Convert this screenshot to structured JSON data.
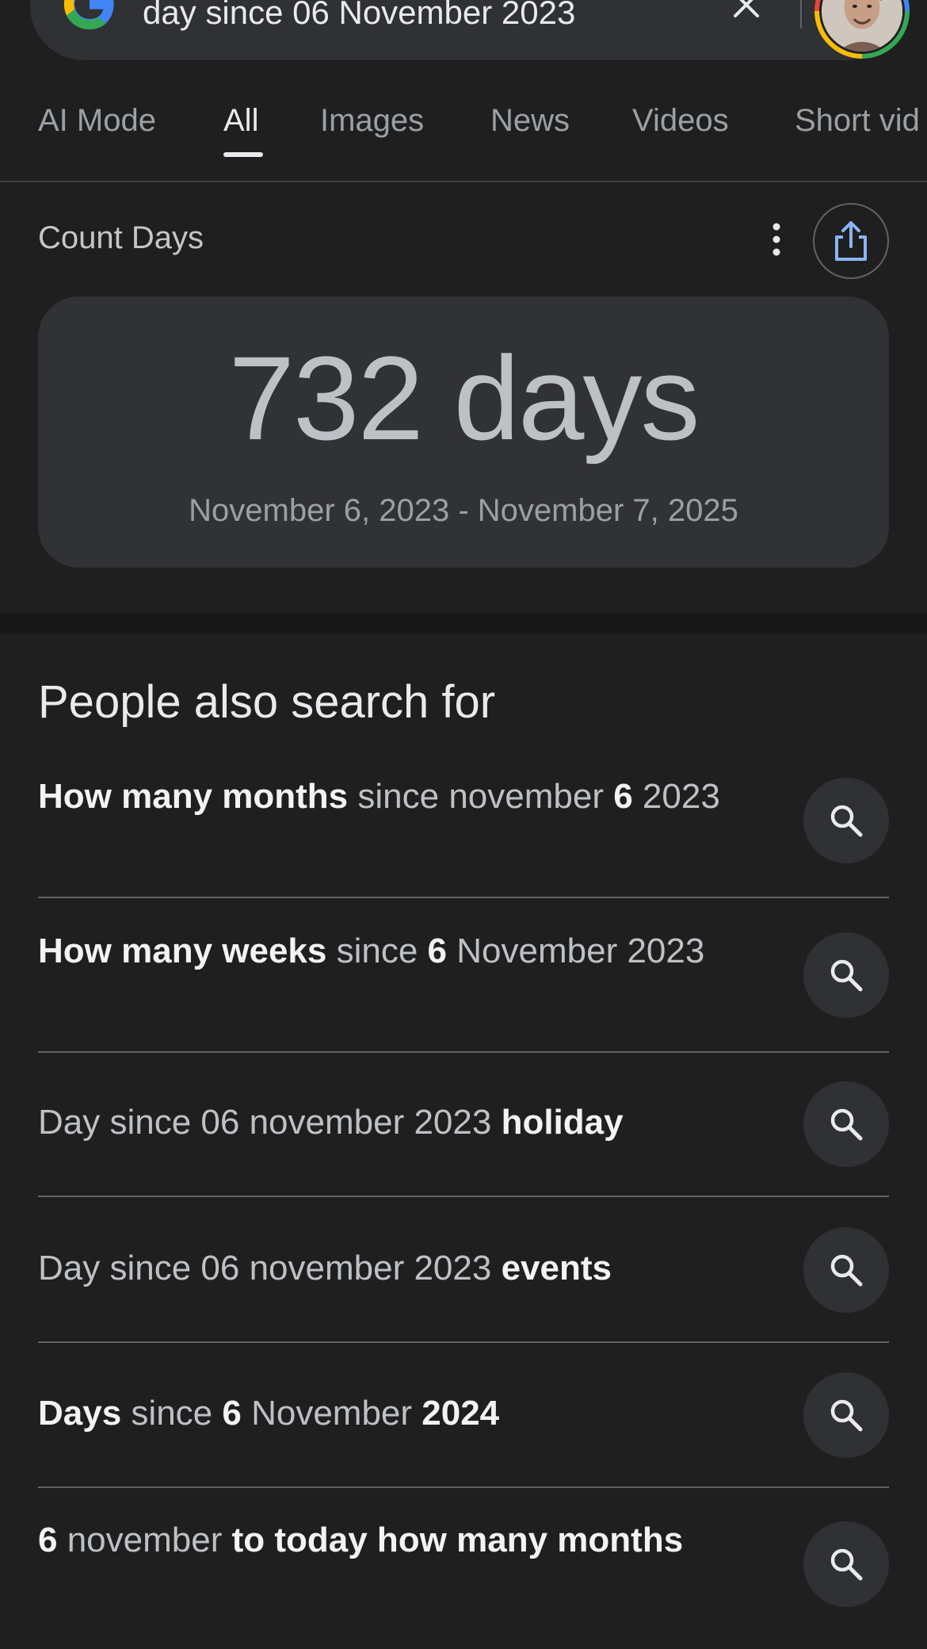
{
  "search": {
    "query": "day since 06 November 2023"
  },
  "tabs": [
    {
      "label": "AI Mode"
    },
    {
      "label": "All"
    },
    {
      "label": "Images"
    },
    {
      "label": "News"
    },
    {
      "label": "Videos"
    },
    {
      "label": "Short vid"
    }
  ],
  "active_tab": "All",
  "count_card": {
    "title": "Count Days",
    "value": "732 days",
    "range": "November 6, 2023 - November 7, 2025"
  },
  "pasf": {
    "title": "People also search for",
    "items": [
      {
        "segments": [
          {
            "t": "How many months",
            "b": true
          },
          {
            "t": " since november ",
            "b": false
          },
          {
            "t": "6",
            "b": true
          },
          {
            "t": " 2023",
            "b": false
          }
        ]
      },
      {
        "segments": [
          {
            "t": "How many weeks",
            "b": true
          },
          {
            "t": " since ",
            "b": false
          },
          {
            "t": "6",
            "b": true
          },
          {
            "t": " November 2023",
            "b": false
          }
        ]
      },
      {
        "segments": [
          {
            "t": "Day since 06 november 2023 ",
            "b": false
          },
          {
            "t": "holiday",
            "b": true
          }
        ]
      },
      {
        "segments": [
          {
            "t": "Day since 06 november 2023 ",
            "b": false
          },
          {
            "t": "events",
            "b": true
          }
        ]
      },
      {
        "segments": [
          {
            "t": "Days",
            "b": true
          },
          {
            "t": " since ",
            "b": false
          },
          {
            "t": "6",
            "b": true
          },
          {
            "t": " November ",
            "b": false
          },
          {
            "t": "2024",
            "b": true
          }
        ]
      },
      {
        "segments": [
          {
            "t": "6",
            "b": true
          },
          {
            "t": " november ",
            "b": false
          },
          {
            "t": "to today how many months",
            "b": true
          }
        ]
      }
    ]
  },
  "icons": {
    "logo": "google-g-icon",
    "clear": "close-icon",
    "more": "more-vert-icon",
    "share": "share-icon",
    "search": "search-icon"
  },
  "colors": {
    "background": "#1f1f1f",
    "surface": "#313235",
    "accent_blue": "#8ab4f8"
  }
}
